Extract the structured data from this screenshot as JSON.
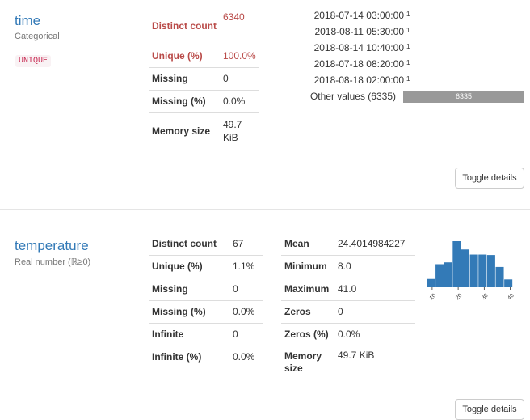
{
  "time": {
    "name": "time",
    "type": "Categorical",
    "badge": "UNIQUE",
    "stats": [
      {
        "label": "Distinct count",
        "value": "6340",
        "alert": true
      },
      {
        "label": "Unique (%)",
        "value": "100.0%",
        "alert": true
      },
      {
        "label": "Missing",
        "value": "0",
        "alert": false
      },
      {
        "label": "Missing (%)",
        "value": "0.0%",
        "alert": false
      },
      {
        "label": "Memory size",
        "value": "49.7 KiB",
        "alert": false
      }
    ],
    "frequencies": [
      {
        "value": "2018-07-14 03:00:00",
        "count": "1"
      },
      {
        "value": "2018-08-11 05:30:00",
        "count": "1"
      },
      {
        "value": "2018-08-14 10:40:00",
        "count": "1"
      },
      {
        "value": "2018-07-18 08:20:00",
        "count": "1"
      },
      {
        "value": "2018-08-18 02:00:00",
        "count": "1"
      }
    ],
    "other_label": "Other values (6335)",
    "other_count": "6335",
    "toggle_label": "Toggle details"
  },
  "temperature": {
    "name": "temperature",
    "type": "Real number (ℝ≥0)",
    "stats_left": [
      {
        "label": "Distinct count",
        "value": "67"
      },
      {
        "label": "Unique (%)",
        "value": "1.1%"
      },
      {
        "label": "Missing",
        "value": "0"
      },
      {
        "label": "Missing (%)",
        "value": "0.0%"
      },
      {
        "label": "Infinite",
        "value": "0"
      },
      {
        "label": "Infinite (%)",
        "value": "0.0%"
      }
    ],
    "stats_right": [
      {
        "label": "Mean",
        "value": "24.4014984227"
      },
      {
        "label": "Minimum",
        "value": "8.0"
      },
      {
        "label": "Maximum",
        "value": "41.0"
      },
      {
        "label": "Zeros",
        "value": "0"
      },
      {
        "label": "Zeros (%)",
        "value": "0.0%"
      },
      {
        "label": "Memory size",
        "value": "49.7 KiB"
      }
    ],
    "toggle_label": "Toggle details"
  },
  "chart_data": {
    "type": "bar",
    "title": "",
    "xlabel": "",
    "ylabel": "",
    "xlim": [
      6,
      42
    ],
    "x_ticks": [
      "10",
      "20",
      "30",
      "40"
    ],
    "bin_edges": [
      8.0,
      11.3,
      14.6,
      17.9,
      21.2,
      24.5,
      27.8,
      31.1,
      34.4,
      37.7,
      41.0
    ],
    "values": [
      0.18,
      0.5,
      0.54,
      1.0,
      0.82,
      0.71,
      0.71,
      0.7,
      0.44,
      0.17
    ],
    "color": "#337ab7"
  },
  "colors": {
    "accent": "#337ab7",
    "alert": "#b94a48",
    "bar": "#337ab7",
    "other_bar": "#999999"
  }
}
